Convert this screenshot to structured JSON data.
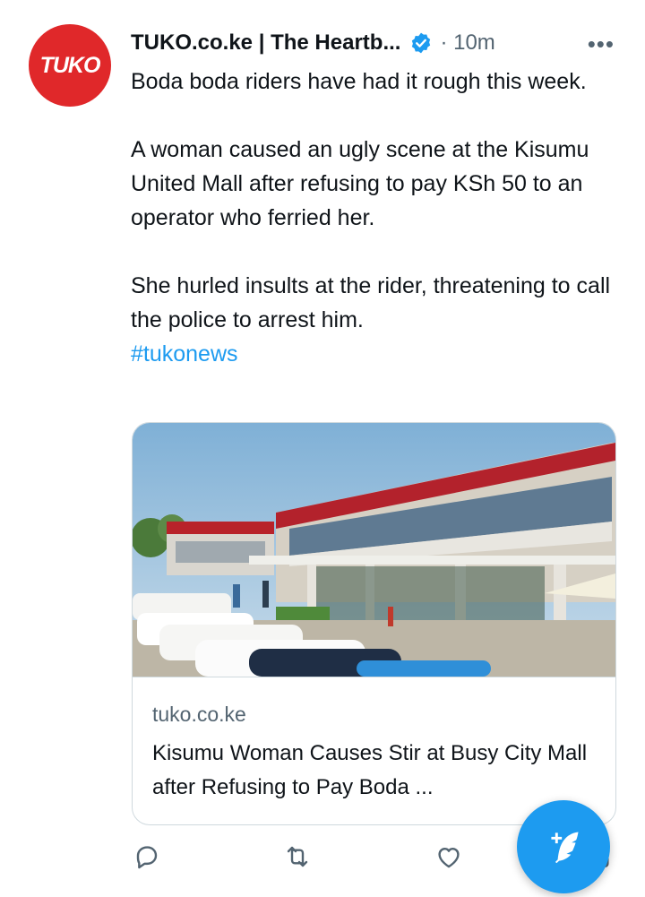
{
  "tweet": {
    "avatar_text": "TUKO",
    "author_name": "TUKO.co.ke | The Heartb...",
    "time": "· 10m",
    "more": "•••",
    "paragraphs": [
      "Boda boda riders have had it rough this week.",
      "A woman caused an ugly scene at the Kisumu United Mall after refusing to pay KSh 50 to an operator who ferried her.",
      "She hurled insults at the rider, threatening to call the police to arrest him."
    ],
    "hashtag": "#tukonews"
  },
  "card": {
    "domain": "tuko.co.ke",
    "title": "Kisumu Woman Causes Stir at Busy City Mall after Refusing to Pay Boda ..."
  },
  "actions": {
    "icons": [
      "reply-icon",
      "retweet-icon",
      "like-icon",
      "share-icon"
    ]
  },
  "compose": {
    "icon": "compose-tweet-icon"
  },
  "colors": {
    "accent": "#1d9bf0",
    "avatar_bg": "#e0282a",
    "secondary_text": "#536471",
    "border": "#cfd9de"
  }
}
